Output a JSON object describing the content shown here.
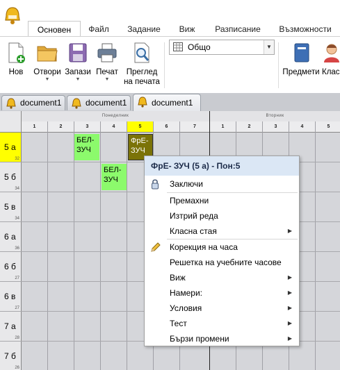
{
  "ribbon_tabs": [
    "Основен",
    "Файл",
    "Задание",
    "Виж",
    "Разписание",
    "Възможности"
  ],
  "ribbon_buttons": {
    "new": "Нов",
    "open": "Отвори",
    "save": "Запази",
    "print": "Печат",
    "preview_line1": "Преглед",
    "preview_line2": "на печата",
    "subjects": "Предмети",
    "classes": "Клас"
  },
  "view_combo": {
    "value": "Общо"
  },
  "doc_tabs": [
    "document1",
    "document1",
    "document1"
  ],
  "grid": {
    "day1": "Понеделник",
    "day2": "Вторник",
    "periods_day1": [
      "1",
      "2",
      "3",
      "4",
      "5",
      "6",
      "7"
    ],
    "periods_day2": [
      "1",
      "2",
      "3",
      "4",
      "5"
    ],
    "rows": [
      {
        "name": "5 а",
        "count": "32"
      },
      {
        "name": "5 б",
        "count": "34"
      },
      {
        "name": "5 в",
        "count": "34"
      },
      {
        "name": "6 а",
        "count": "36"
      },
      {
        "name": "6 б",
        "count": "27"
      },
      {
        "name": "6 в",
        "count": "27"
      },
      {
        "name": "7 а",
        "count": "28"
      },
      {
        "name": "7 б",
        "count": "26"
      }
    ],
    "cards": [
      {
        "line1": "БЕЛ-",
        "line2": "ЗУЧ",
        "color": "#8cfa6c"
      },
      {
        "line1": "ФрЕ-",
        "line2": "ЗУЧ",
        "color": "#7b7308"
      },
      {
        "line1": "БЕЛ-",
        "line2": "ЗУЧ",
        "color": "#8cfa6c"
      }
    ]
  },
  "context_menu": {
    "title": "ФрЕ- ЗУЧ (5 а) - Пон:5",
    "items": [
      "Заключи",
      "Премахни",
      "Изтрий реда",
      "Класна стая",
      "Корекция на часа",
      "Решетка на учебните часове",
      "Виж",
      "Намери:",
      "Условия",
      "Тест",
      "Бързи промени"
    ]
  }
}
